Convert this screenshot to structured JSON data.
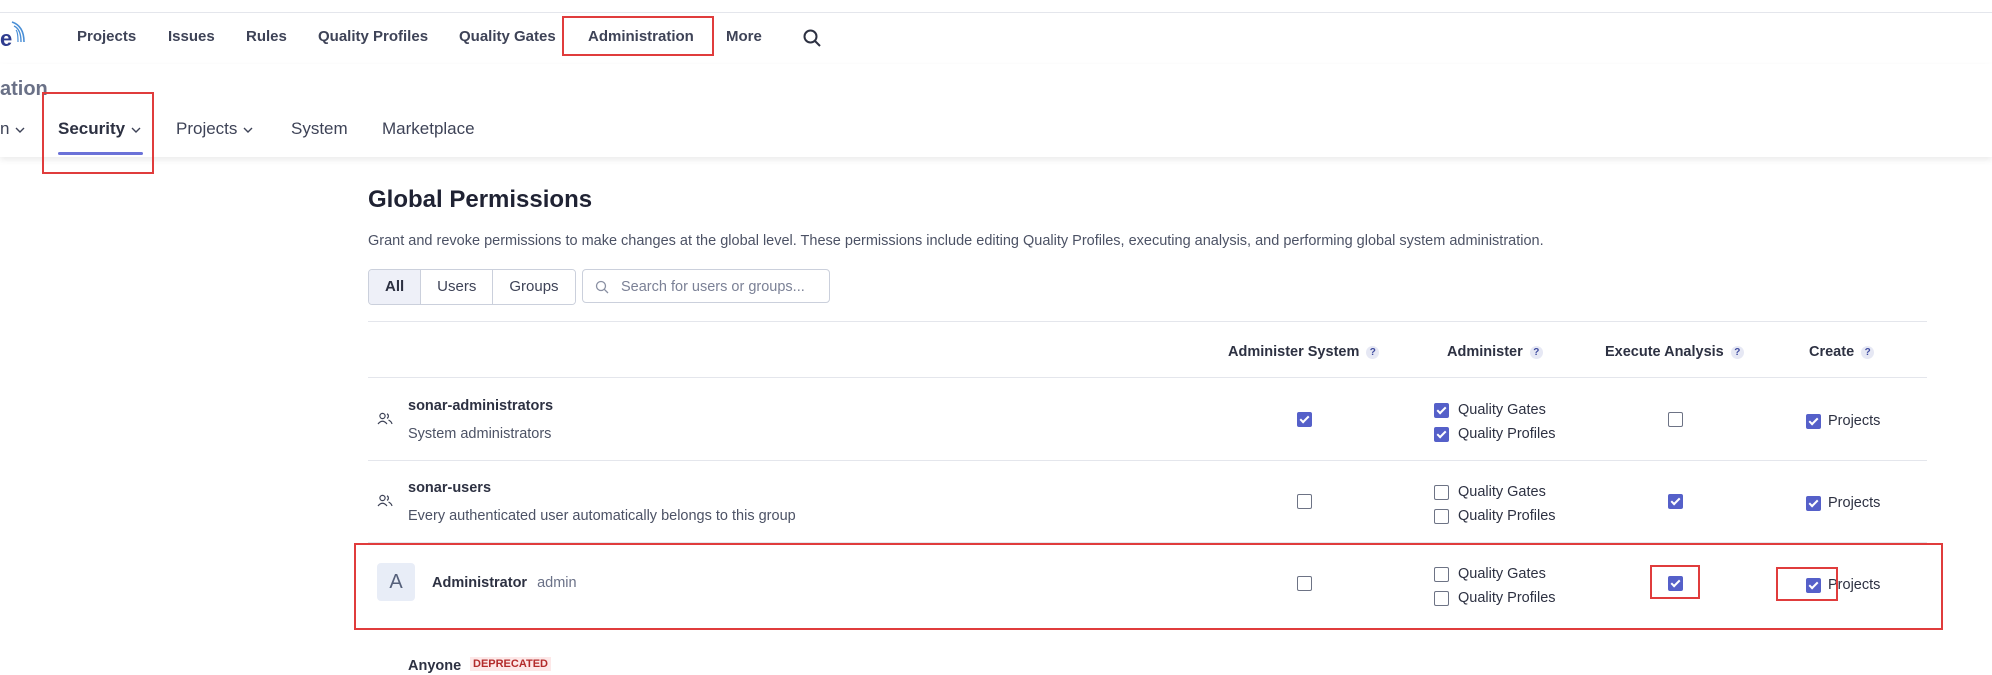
{
  "nav": {
    "items": [
      "Projects",
      "Issues",
      "Rules",
      "Quality Profiles",
      "Quality Gates",
      "Administration",
      "More"
    ],
    "logo_text": "e"
  },
  "admin": {
    "title": "ation",
    "tabs": [
      "n",
      "Security",
      "Projects",
      "System",
      "Marketplace"
    ]
  },
  "page": {
    "title": "Global Permissions",
    "description": "Grant and revoke permissions to make changes at the global level. These permissions include editing Quality Profiles, executing analysis, and performing global system administration.",
    "filters": [
      "All",
      "Users",
      "Groups"
    ],
    "active_filter": "All",
    "search_placeholder": "Search for users or groups..."
  },
  "columns": [
    "Administer System",
    "Administer",
    "Execute Analysis",
    "Create"
  ],
  "help_glyph": "?",
  "rows": [
    {
      "type": "group",
      "name": "sonar-administrators",
      "description": "System administrators",
      "admin_system": true,
      "quality_gates": true,
      "quality_profiles": true,
      "execute_analysis": false,
      "create_projects": true
    },
    {
      "type": "group",
      "name": "sonar-users",
      "description": "Every authenticated user automatically belongs to this group",
      "admin_system": false,
      "quality_gates": false,
      "quality_profiles": false,
      "execute_analysis": true,
      "create_projects": true
    },
    {
      "type": "user",
      "avatar_letter": "A",
      "name": "Administrator",
      "login": "admin",
      "admin_system": false,
      "quality_gates": false,
      "quality_profiles": false,
      "execute_analysis": true,
      "create_projects": true
    },
    {
      "type": "group",
      "name": "Anyone",
      "badge": "DEPRECATED"
    }
  ],
  "labels": {
    "quality_gates": "Quality Gates",
    "quality_profiles": "Quality Profiles",
    "projects": "Projects"
  }
}
